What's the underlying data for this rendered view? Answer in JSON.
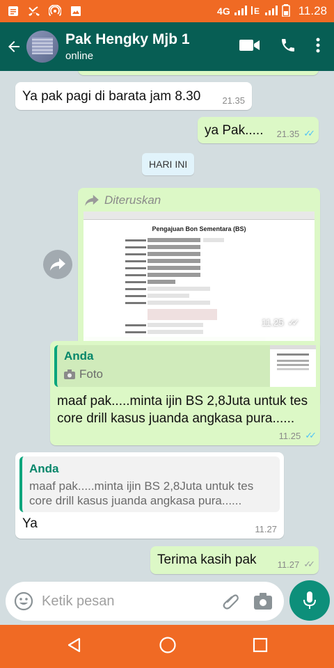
{
  "statusbar": {
    "network": "4G",
    "time": "11.28"
  },
  "header": {
    "contact_name": "Pak Hengky Mjb 1",
    "status": "online"
  },
  "messages": [
    {
      "dir": "in",
      "text": "Ya pak pagi di barata jam 8.30",
      "time": "21.35"
    },
    {
      "dir": "out",
      "text": "ya Pak.....",
      "time": "21.35",
      "ticks": "read"
    },
    {
      "type": "date",
      "text": "HARI INI"
    },
    {
      "dir": "out",
      "type": "forwarded-image",
      "forward_label": "Diteruskan",
      "doc_title": "Pengajuan Bon Sementara (BS)",
      "time": "11.25",
      "ticks": "read"
    },
    {
      "dir": "out",
      "quote_author": "Anda",
      "quote_type": "Foto",
      "text": "maaf pak.....minta ijin BS 2,8Juta untuk tes core drill kasus juanda angkasa pura......",
      "time": "11.25",
      "ticks": "read"
    },
    {
      "dir": "in",
      "quote_author": "Anda",
      "quote_text": "maaf pak.....minta ijin BS 2,8Juta untuk tes core drill kasus juanda angkasa pura......",
      "text": "Ya",
      "time": "11.27"
    },
    {
      "dir": "out",
      "text": "Terima kasih pak",
      "time": "11.27",
      "ticks": "delivered"
    }
  ],
  "composer": {
    "placeholder": "Ketik pesan"
  },
  "colors": {
    "statusbar": "#f06a24",
    "appbar": "#075e54",
    "outgoing": "#dcf8c6",
    "incoming": "#ffffff",
    "read_ticks": "#4fc3f7",
    "accent": "#0d8f7a"
  }
}
